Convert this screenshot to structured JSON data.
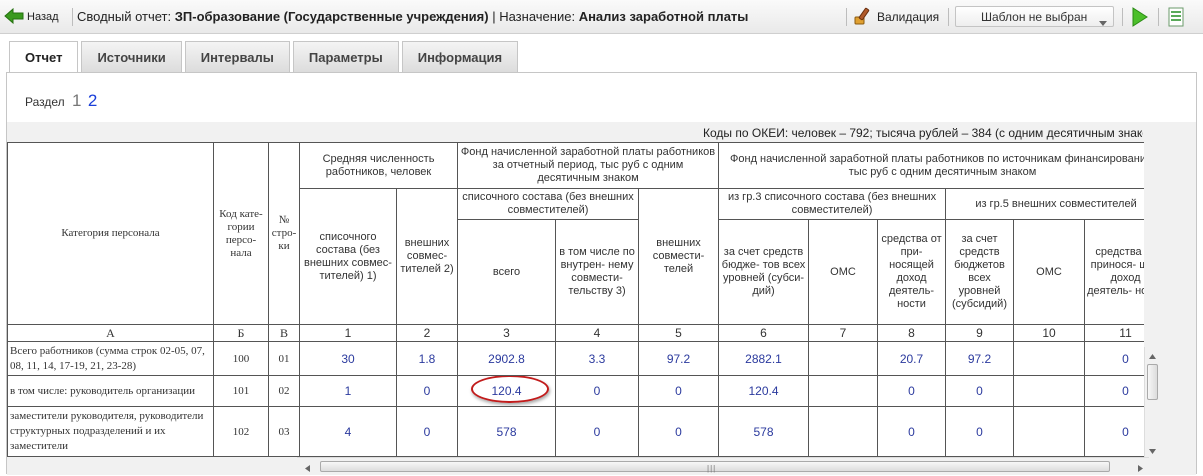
{
  "toolbar": {
    "back_label": "Назад",
    "title_prefix": "Сводный отчет:",
    "title_value": "ЗП-образование (Государственные учреждения)",
    "title_sep": "| Назначение:",
    "purpose_value": "Анализ заработной платы",
    "validate_label": "Валидация",
    "template_selected": "Шаблон не выбран",
    "icons": {
      "back": "arrow-left-icon",
      "validate": "validation-icon",
      "run": "play-icon",
      "export": "excel-export-icon",
      "dropdown": "chevron-down-icon"
    }
  },
  "tabs": [
    {
      "label": "Отчет",
      "active": true
    },
    {
      "label": "Источники",
      "active": false
    },
    {
      "label": "Интервалы",
      "active": false
    },
    {
      "label": "Параметры",
      "active": false
    },
    {
      "label": "Информация",
      "active": false
    }
  ],
  "section": {
    "label": "Раздел",
    "pages": [
      "1",
      "2"
    ],
    "current": "2"
  },
  "okei_text": "Коды по ОКЕИ: человек – 792; тысяча рублей – 384 (с одним десятичным знаком)",
  "table": {
    "h_category": "Категория персонала",
    "h_code": "Код кате- гории персо- нала",
    "h_rownum": "№ стро- ки",
    "h_avg_count": "Средняя численность работников, человек",
    "h_avg_list": "списочного состава (без внешних совмес- тителей) 1)",
    "h_avg_external": "внешних совмес- тителей 2)",
    "h_fund": "Фонд начисленной заработной платы работников за отчетный период, тыс руб с одним десятичным знаком",
    "h_fund_list": "списочного состава (без внешних совместителей)",
    "h_fund_total": "всего",
    "h_fund_internal": "в том числе по внутрен- нему совмести- тельству 3)",
    "h_fund_external": "внешних совмести- телей",
    "h_src": "Фонд начисленной заработной платы работников по источникам финансирования, тыс руб с одним десятичным знаком",
    "h_src_g3": "из гр.3 списочного состава (без внешних совместителей)",
    "h_src_g5": "из гр.5 внешних совместителей",
    "h_g3_budget": "за счет средств бюдже- тов всех уровней (субси- дий)",
    "h_g3_oms": "ОМС",
    "h_g3_income": "средства от при- носящей доход деятель- ности",
    "h_g5_budget": "за счет средств бюджетов всех уровней (субсидий)",
    "h_g5_oms": "ОМС",
    "h_g5_income": "средства от принося- щей доход деятель- ности",
    "index_row": [
      "А",
      "Б",
      "В",
      "1",
      "2",
      "3",
      "4",
      "5",
      "6",
      "7",
      "8",
      "9",
      "10",
      "11"
    ],
    "rows": [
      {
        "label": "Всего работников (сумма строк 02-05, 07, 08, 11, 14, 17-19, 21, 23-28)",
        "code": "100",
        "row": "01",
        "values": [
          "30",
          "1.8",
          "2902.8",
          "3.3",
          "97.2",
          "2882.1",
          "",
          "20.7",
          "97.2",
          "",
          "0"
        ]
      },
      {
        "label": "в том числе: руководитель организации",
        "code": "101",
        "row": "02",
        "values": [
          "1",
          "0",
          "120.4",
          "0",
          "0",
          "120.4",
          "",
          "0",
          "0",
          "",
          "0"
        ]
      },
      {
        "label": "заместители руководителя, руководители структурных подразделений и их заместители",
        "code": "102",
        "row": "03",
        "values": [
          "4",
          "0",
          "578",
          "0",
          "0",
          "578",
          "",
          "0",
          "0",
          "",
          "0"
        ]
      }
    ],
    "highlighted_cell": "120.4"
  }
}
